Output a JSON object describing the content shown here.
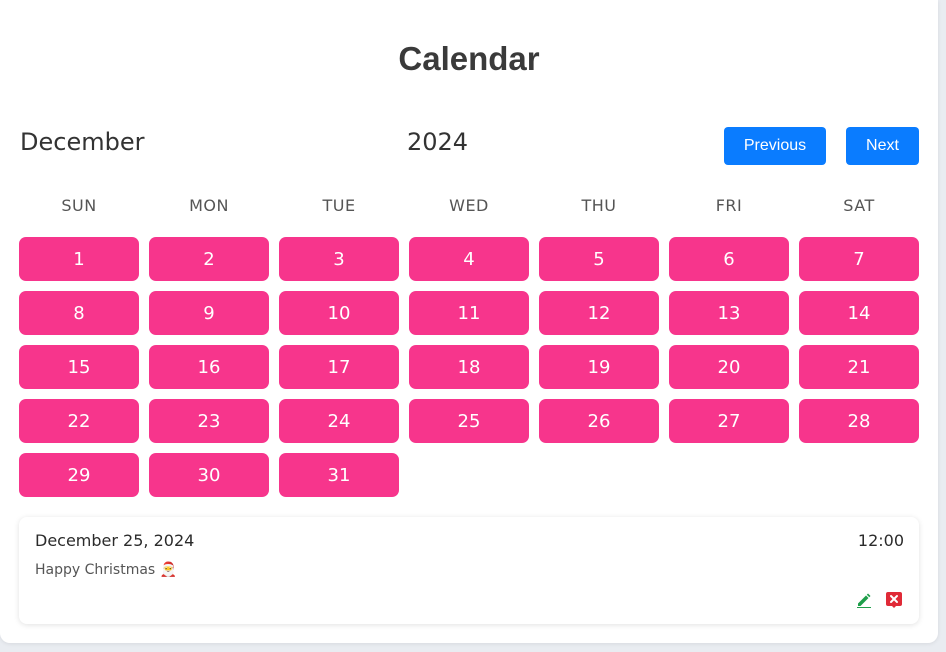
{
  "page": {
    "title": "Calendar"
  },
  "nav": {
    "month": "December",
    "year": "2024",
    "previous_label": "Previous",
    "next_label": "Next"
  },
  "weekdays": [
    "SUN",
    "MON",
    "TUE",
    "WED",
    "THU",
    "FRI",
    "SAT"
  ],
  "days": [
    "1",
    "2",
    "3",
    "4",
    "5",
    "6",
    "7",
    "8",
    "9",
    "10",
    "11",
    "12",
    "13",
    "14",
    "15",
    "16",
    "17",
    "18",
    "19",
    "20",
    "21",
    "22",
    "23",
    "24",
    "25",
    "26",
    "27",
    "28",
    "29",
    "30",
    "31"
  ],
  "event": {
    "date": "December 25, 2024",
    "time": "12:00",
    "text": "Happy Christmas 🎅",
    "edit_icon": "pencil-icon",
    "delete_icon": "delete-x-icon"
  },
  "colors": {
    "day_bg": "#f7358c",
    "button_bg": "#0a7cff",
    "edit_icon": "#1e9e4a",
    "delete_icon": "#e02a37"
  }
}
